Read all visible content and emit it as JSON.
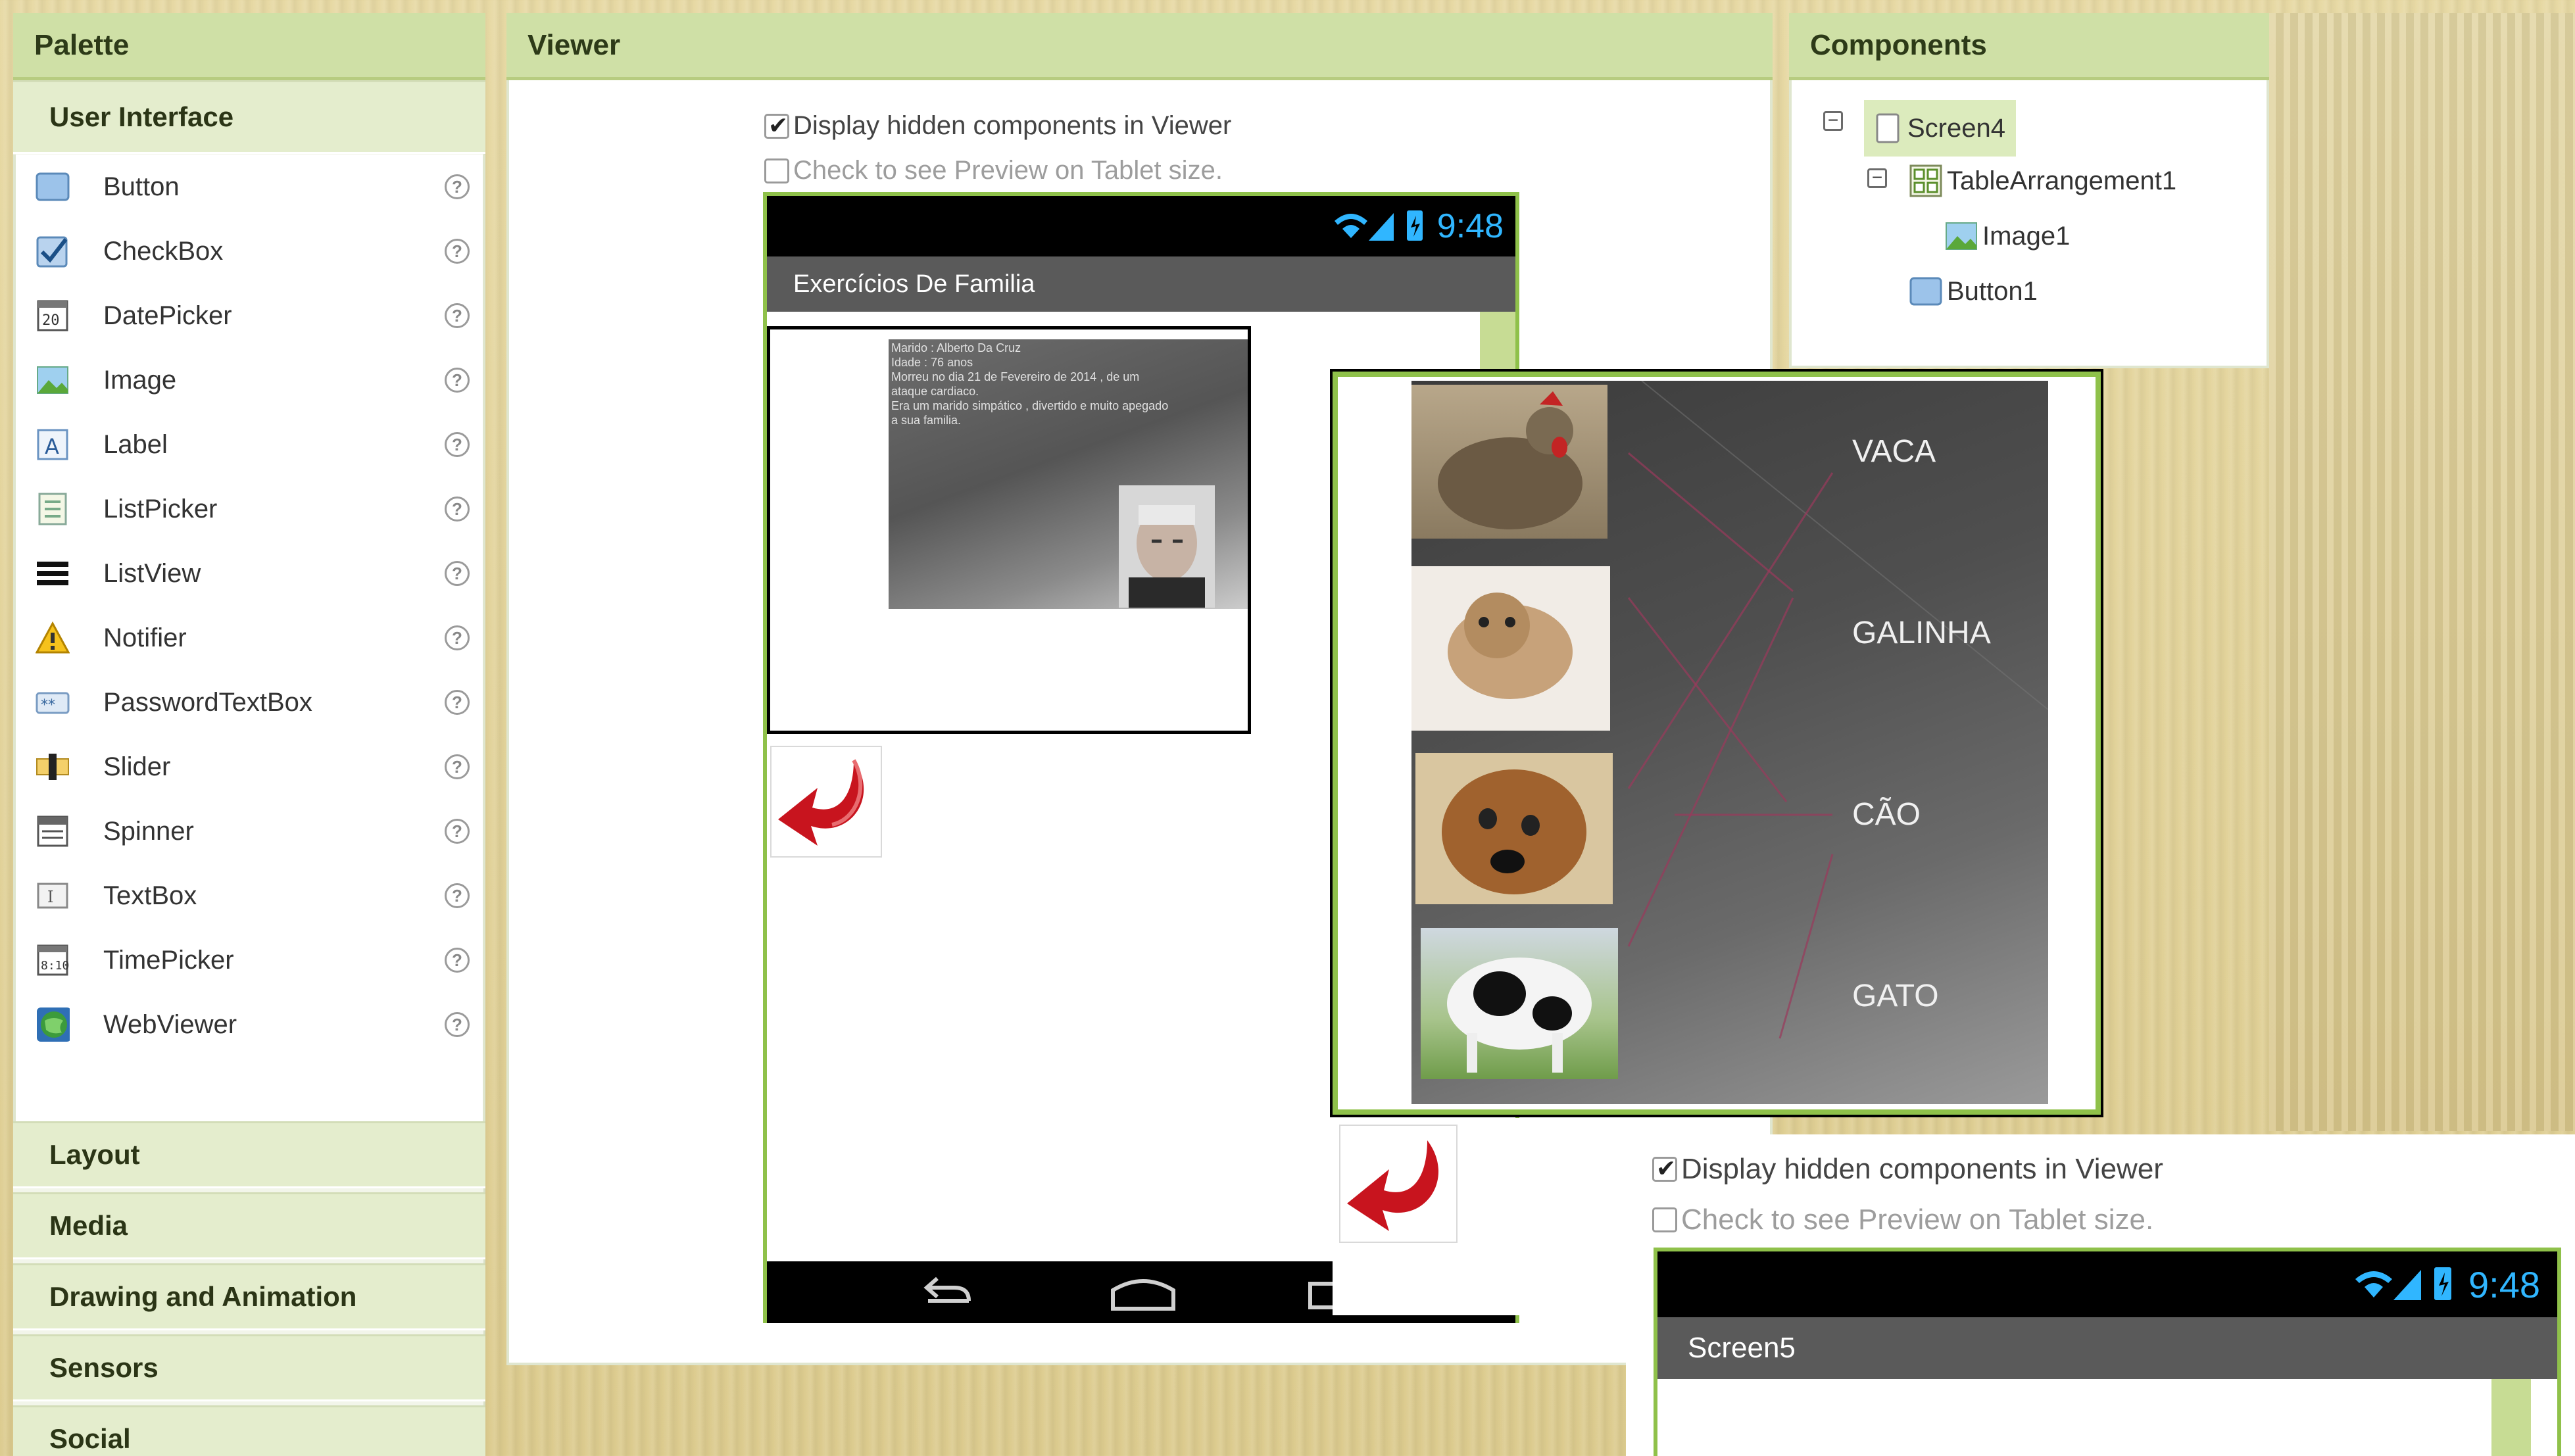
{
  "palette": {
    "title": "Palette",
    "category_open": "User Interface",
    "items": [
      {
        "label": "Button",
        "icon": "button-icon"
      },
      {
        "label": "CheckBox",
        "icon": "checkbox-icon"
      },
      {
        "label": "DatePicker",
        "icon": "calendar-icon"
      },
      {
        "label": "Image",
        "icon": "image-icon"
      },
      {
        "label": "Label",
        "icon": "label-icon"
      },
      {
        "label": "ListPicker",
        "icon": "listpicker-icon"
      },
      {
        "label": "ListView",
        "icon": "listview-icon"
      },
      {
        "label": "Notifier",
        "icon": "warning-icon"
      },
      {
        "label": "PasswordTextBox",
        "icon": "password-icon"
      },
      {
        "label": "Slider",
        "icon": "slider-icon"
      },
      {
        "label": "Spinner",
        "icon": "spinner-icon"
      },
      {
        "label": "TextBox",
        "icon": "textbox-icon"
      },
      {
        "label": "TimePicker",
        "icon": "clock-icon"
      },
      {
        "label": "WebViewer",
        "icon": "globe-icon"
      }
    ],
    "help_glyph": "?",
    "categories": [
      "Layout",
      "Media",
      "Drawing and Animation",
      "Sensors",
      "Social"
    ]
  },
  "viewer": {
    "title": "Viewer",
    "display_hidden_label": "Display hidden components in Viewer",
    "display_hidden_checked": true,
    "tablet_preview_label": "Check to see Preview on Tablet size.",
    "tablet_preview_checked": false,
    "phone": {
      "time": "9:48",
      "screen_title": "Exercícios De Familia",
      "card_text": [
        "Marido : Alberto Da Cruz",
        "Idade : 76 anos",
        "Morreu no dia 21 de Fevereiro de 2014 , de um",
        "ataque cardiaco.",
        "Era um marido simpático , divertido e muito apegado",
        "a sua    familia."
      ]
    }
  },
  "quiz_overlay": {
    "words": [
      "VACA",
      "GALINHA",
      "CÃO",
      "GATO"
    ],
    "animals": [
      "chicken-photo",
      "kitten-photo",
      "puppy-photo",
      "cow-photo"
    ]
  },
  "components": {
    "title": "Components",
    "tree": [
      {
        "label": "Screen4",
        "icon": "screen-icon",
        "level": 0,
        "selected": true
      },
      {
        "label": "TableArrangement1",
        "icon": "table-arrangement-icon",
        "level": 1
      },
      {
        "label": "Image1",
        "icon": "image-icon",
        "level": 2
      },
      {
        "label": "Button1",
        "icon": "button-icon",
        "level": 1
      }
    ]
  },
  "second_viewer": {
    "display_hidden_label": "Display hidden components in Viewer",
    "tablet_preview_label": "Check to see Preview on Tablet size.",
    "time": "9:48",
    "screen_title": "Screen5"
  },
  "colors": {
    "header_green": "#cfe0a6",
    "phone_border": "#8fc14a",
    "status_icon_blue": "#30b6ff",
    "arrow_red": "#c8141e"
  }
}
